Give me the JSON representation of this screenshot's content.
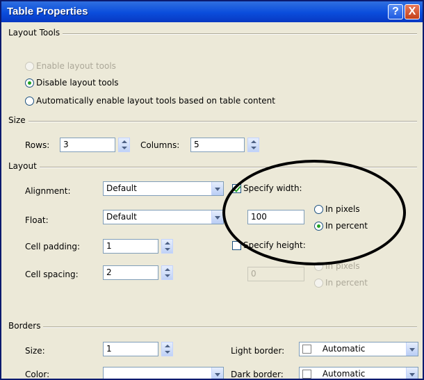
{
  "window": {
    "title": "Table Properties",
    "help_label": "?",
    "close_label": "X"
  },
  "layout_tools": {
    "group_title": "Layout Tools",
    "options": [
      {
        "label": "Enable layout tools",
        "selected": false,
        "enabled": false
      },
      {
        "label": "Disable layout tools",
        "selected": true,
        "enabled": true
      },
      {
        "label": "Automatically enable layout tools based on table content",
        "selected": false,
        "enabled": true
      }
    ]
  },
  "size": {
    "group_title": "Size",
    "rows_label": "Rows:",
    "rows_value": "3",
    "columns_label": "Columns:",
    "columns_value": "5"
  },
  "layout": {
    "group_title": "Layout",
    "alignment_label": "Alignment:",
    "alignment_value": "Default",
    "float_label": "Float:",
    "float_value": "Default",
    "cell_padding_label": "Cell padding:",
    "cell_padding_value": "1",
    "cell_spacing_label": "Cell spacing:",
    "cell_spacing_value": "2",
    "specify_width_label": "Specify width:",
    "specify_width_checked": true,
    "width_value": "100",
    "width_units": [
      {
        "label": "In pixels",
        "selected": false
      },
      {
        "label": "In percent",
        "selected": true
      }
    ],
    "specify_height_label": "Specify height:",
    "specify_height_checked": false,
    "height_value": "0",
    "height_units": [
      {
        "label": "In pixels",
        "selected": false
      },
      {
        "label": "In percent",
        "selected": false
      }
    ]
  },
  "borders": {
    "group_title": "Borders",
    "size_label": "Size:",
    "size_value": "1",
    "color_label": "Color:",
    "color_value": "",
    "light_border_label": "Light border:",
    "light_border_value": "Automatic",
    "dark_border_label": "Dark border:",
    "dark_border_value": "Automatic"
  }
}
